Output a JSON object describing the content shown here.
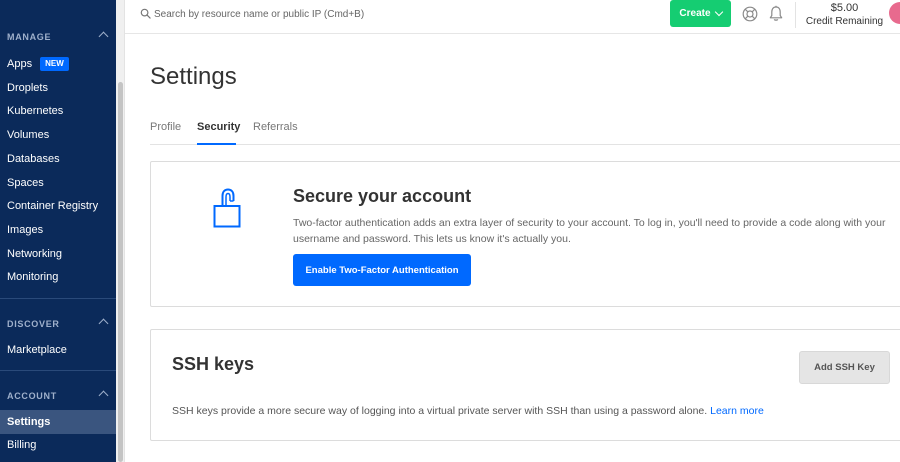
{
  "sidebar": {
    "sections": [
      {
        "header": "MANAGE"
      },
      {
        "header": "DISCOVER"
      },
      {
        "header": "ACCOUNT"
      }
    ],
    "manage_items": [
      {
        "label": "Apps",
        "badge": "NEW"
      },
      {
        "label": "Droplets"
      },
      {
        "label": "Kubernetes"
      },
      {
        "label": "Volumes"
      },
      {
        "label": "Databases"
      },
      {
        "label": "Spaces"
      },
      {
        "label": "Container Registry"
      },
      {
        "label": "Images"
      },
      {
        "label": "Networking"
      },
      {
        "label": "Monitoring"
      }
    ],
    "discover_items": [
      {
        "label": "Marketplace"
      }
    ],
    "account_items": [
      {
        "label": "Settings",
        "active": true
      },
      {
        "label": "Billing"
      }
    ]
  },
  "topbar": {
    "search_placeholder": "Search by resource name or public IP (Cmd+B)",
    "create_label": "Create",
    "credit_amount": "$5.00",
    "credit_label": "Credit Remaining"
  },
  "main": {
    "title": "Settings",
    "tabs": [
      {
        "label": "Profile"
      },
      {
        "label": "Security",
        "active": true
      },
      {
        "label": "Referrals"
      }
    ],
    "two_factor": {
      "title": "Secure your account",
      "description": "Two-factor authentication adds an extra layer of security to your account. To log in, you'll need to provide a code along with your username and password. This lets us know it's actually you.",
      "button_label": "Enable Two-Factor Authentication"
    },
    "ssh": {
      "title": "SSH keys",
      "button_label": "Add SSH Key",
      "description": "SSH keys provide a more secure way of logging into a virtual private server with SSH than using a password alone.",
      "link_label": "Learn more"
    }
  },
  "colors": {
    "sidebar_bg": "#0b2a5a",
    "accent": "#0069ff",
    "create_green": "#15cd72"
  }
}
